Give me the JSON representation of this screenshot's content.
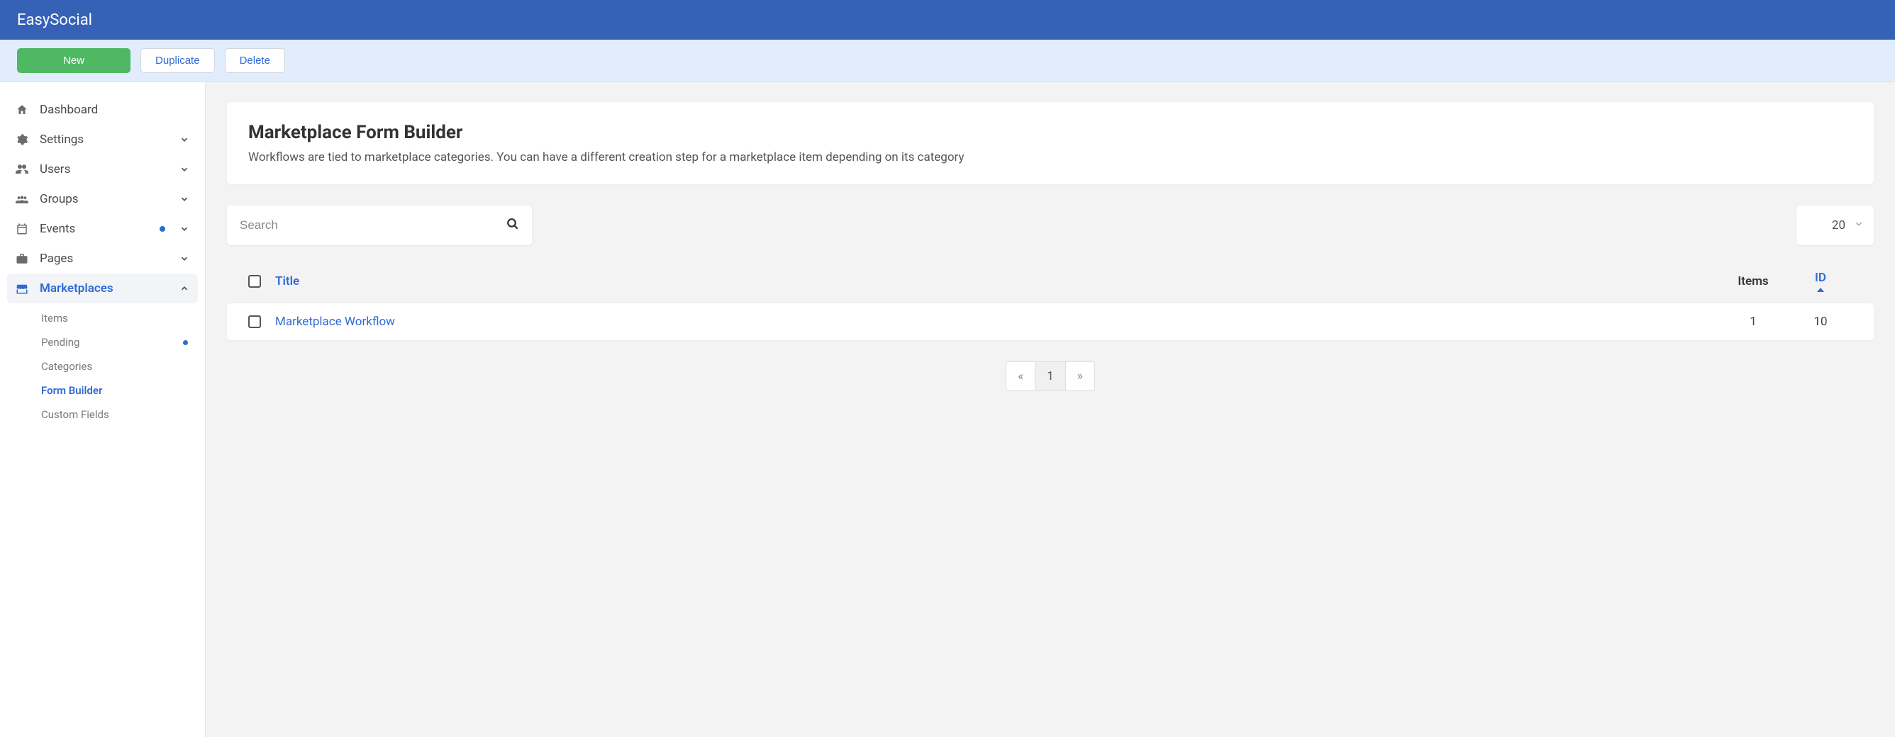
{
  "brand": "EasySocial",
  "toolbar": {
    "new": "New",
    "duplicate": "Duplicate",
    "delete": "Delete"
  },
  "sidebar": {
    "items": [
      {
        "icon": "home",
        "label": "Dashboard"
      },
      {
        "icon": "cogs",
        "label": "Settings",
        "expandable": true
      },
      {
        "icon": "users",
        "label": "Users",
        "expandable": true
      },
      {
        "icon": "group",
        "label": "Groups",
        "expandable": true
      },
      {
        "icon": "calendar",
        "label": "Events",
        "expandable": true,
        "dot": true
      },
      {
        "icon": "briefcase",
        "label": "Pages",
        "expandable": true
      },
      {
        "icon": "store",
        "label": "Marketplaces",
        "expandable": true,
        "active": true
      }
    ],
    "sub": [
      {
        "label": "Items"
      },
      {
        "label": "Pending",
        "dot": true
      },
      {
        "label": "Categories"
      },
      {
        "label": "Form Builder",
        "active": true
      },
      {
        "label": "Custom Fields"
      }
    ]
  },
  "page": {
    "title": "Marketplace Form Builder",
    "desc": "Workflows are tied to marketplace categories. You can have a different creation step for a marketplace item depending on its category"
  },
  "search": {
    "placeholder": "Search"
  },
  "pagesize": {
    "value": "20"
  },
  "table": {
    "headers": {
      "title": "Title",
      "items": "Items",
      "id": "ID"
    },
    "rows": [
      {
        "title": "Marketplace Workflow",
        "items": "1",
        "id": "10"
      }
    ]
  },
  "pagination": {
    "prev": "«",
    "current": "1",
    "next": "»"
  }
}
